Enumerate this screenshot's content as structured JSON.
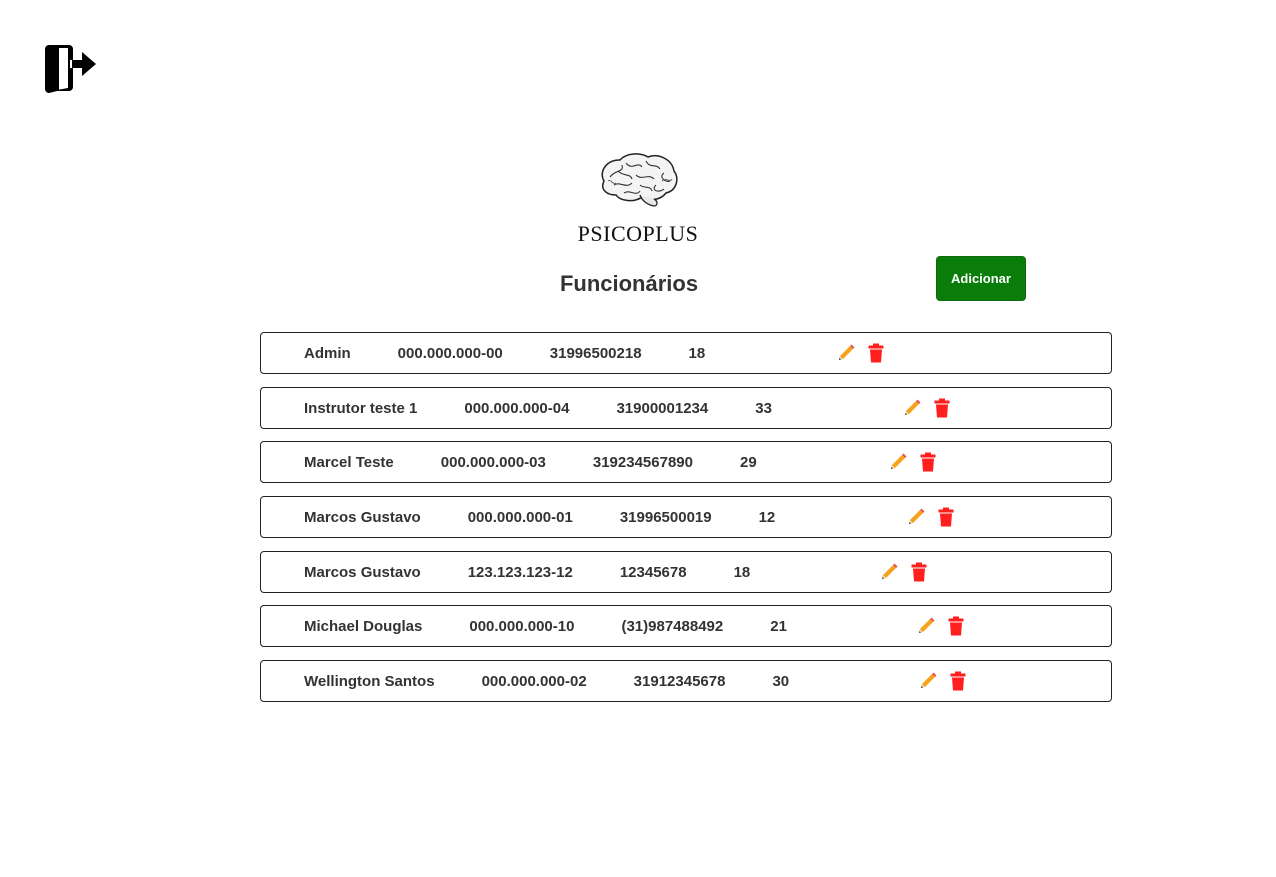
{
  "app": {
    "brand": "PSICOPLUS",
    "page_title": "Funcionários"
  },
  "toolbar": {
    "add_label": "Adicionar",
    "add_color": "#0a7c0a"
  },
  "icons": {
    "logout": "logout-icon",
    "logo": "brain-icon",
    "edit": "pencil-icon",
    "delete": "trash-icon",
    "delete_color": "#ff1f1f"
  },
  "employees": [
    {
      "name": "Admin",
      "cpf": "000.000.000-00",
      "phone": "31996500218",
      "value": "18"
    },
    {
      "name": "Instrutor teste 1",
      "cpf": "000.000.000-04",
      "phone": "31900001234",
      "value": "33"
    },
    {
      "name": "Marcel Teste",
      "cpf": "000.000.000-03",
      "phone": "319234567890",
      "value": "29"
    },
    {
      "name": "Marcos Gustavo",
      "cpf": "000.000.000-01",
      "phone": "31996500019",
      "value": "12"
    },
    {
      "name": "Marcos Gustavo",
      "cpf": "123.123.123-12",
      "phone": "12345678",
      "value": "18"
    },
    {
      "name": "Michael Douglas",
      "cpf": "000.000.000-10",
      "phone": "(31)987488492",
      "value": "21"
    },
    {
      "name": "Wellington Santos",
      "cpf": "000.000.000-02",
      "phone": "31912345678",
      "value": "30"
    }
  ]
}
